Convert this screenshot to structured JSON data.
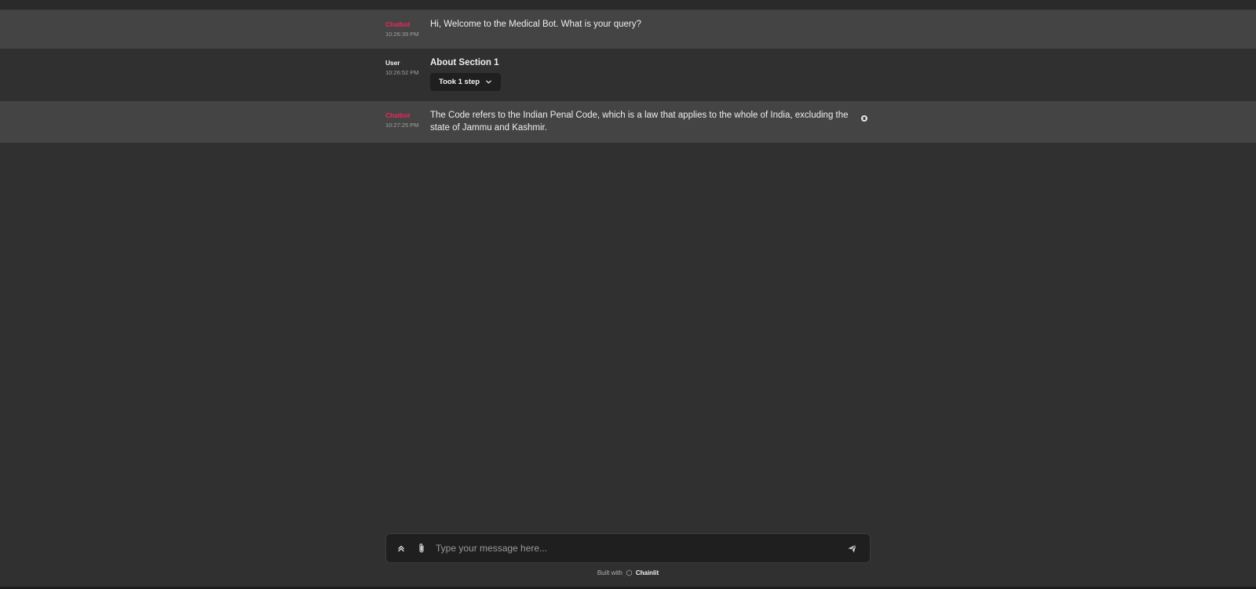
{
  "messages": [
    {
      "author": "Chatbot",
      "time": "10:26:39 PM",
      "text": "Hi, Welcome to the Medical Bot. What is your query?"
    },
    {
      "author": "User",
      "time": "10:26:52 PM",
      "text": "About Section 1",
      "step_label": "Took 1 step"
    },
    {
      "author": "Chatbot",
      "time": "10:27:25 PM",
      "text": "The Code refers to the Indian Penal Code, which is a law that applies to the whole of India, excluding the state of Jammu and Kashmir."
    }
  ],
  "composer": {
    "placeholder": "Type your message here...",
    "value": ""
  },
  "footer": {
    "built_with": "Built with",
    "brand": "Chainlit"
  },
  "icons": {
    "settings": "chevrons-up-icon",
    "attach": "paperclip-icon",
    "send": "send-icon",
    "expand": "chevron-down-icon",
    "copy": "copy-icon",
    "brand_logo": "chainlit-logo-icon"
  },
  "colors": {
    "bot_author": "#f0245d",
    "bot_row_bg": "#444444",
    "page_bg": "#303030",
    "composer_bg": "#1f1f1f"
  }
}
